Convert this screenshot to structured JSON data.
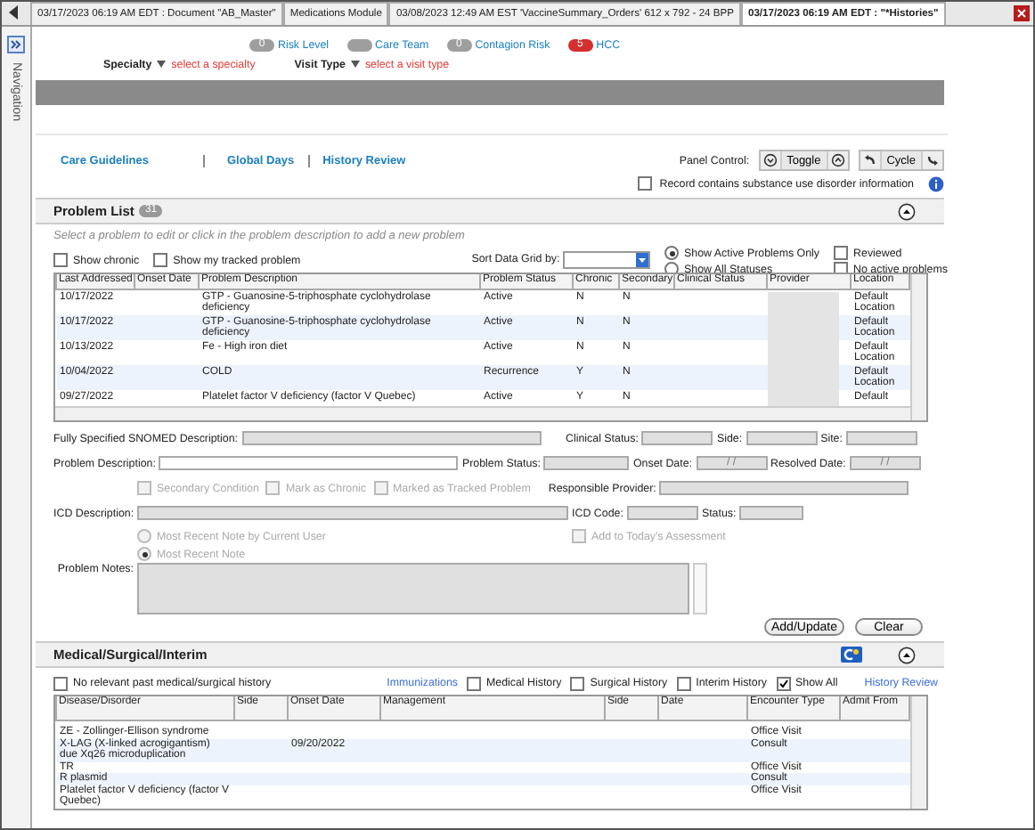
{
  "tabs": [
    {
      "label": "03/17/2023 06:19 AM EDT : Document \"AB_Master\"",
      "selected": false
    },
    {
      "label": "Medications Module",
      "selected": false
    },
    {
      "label": "03/08/2023 12:49 AM EST 'VaccineSummary_Orders' 612 x 792 - 24 BPP",
      "selected": false
    },
    {
      "label": "03/17/2023 06:19 AM EDT : \"*Histories\"",
      "selected": true
    }
  ],
  "navigation": {
    "label": "Navigation"
  },
  "indicators": [
    {
      "label": "Risk Level",
      "count": "0",
      "color": "#9e9e9e"
    },
    {
      "label": "Care Team",
      "color": "#9e9e9e"
    },
    {
      "label": "Contagion Risk",
      "count": "0",
      "color": "#9e9e9e"
    },
    {
      "label": "HCC",
      "count": "5",
      "color": "#d32f2f"
    }
  ],
  "selectors": [
    {
      "label": "Specialty",
      "value": "select a specialty"
    },
    {
      "label": "Visit Type",
      "value": "select a visit type"
    }
  ],
  "links": [
    "Care Guidelines",
    "Global Days",
    "History Review"
  ],
  "panel_control": {
    "label": "Panel Control:",
    "buttons": [
      "Toggle",
      "Cycle"
    ]
  },
  "substance_checkbox": {
    "label": "Record contains substance use disorder information",
    "checked": false
  },
  "problem_list": {
    "title": "Problem List",
    "count": "31",
    "hint": "Select a problem to edit or click in the problem description to add a new problem",
    "checkboxes": [
      {
        "label": "Show chronic",
        "checked": false
      },
      {
        "label": "Show my tracked problem",
        "checked": false
      }
    ],
    "sort_label": "Sort Data Grid by:",
    "status_filter": [
      {
        "label": "Show Active Problems Only",
        "selected": true
      },
      {
        "label": "Show All Statuses",
        "selected": false
      }
    ],
    "extra_checkboxes": [
      {
        "label": "Reviewed",
        "checked": false
      },
      {
        "label": "No active problems",
        "checked": false
      }
    ],
    "columns": [
      "Last Addressed",
      "Onset Date",
      "Problem Description",
      "Problem Status",
      "Chronic",
      "Secondary",
      "Clinical Status",
      "Provider",
      "Location"
    ],
    "rows": [
      {
        "last_addressed": "10/17/2022",
        "problem_description": "GTP - Guanosine-5-triphosphate cyclohydrolase deficiency",
        "problem_status": "Active",
        "chronic": "N",
        "secondary": "N",
        "location": "Default Location"
      },
      {
        "last_addressed": "10/17/2022",
        "problem_description": "GTP - Guanosine-5-triphosphate cyclohydrolase deficiency",
        "problem_status": "Active",
        "chronic": "N",
        "secondary": "N",
        "location": "Default Location"
      },
      {
        "last_addressed": "10/13/2022",
        "problem_description": "Fe - High iron diet",
        "problem_status": "Active",
        "chronic": "N",
        "secondary": "N",
        "location": "Default Location"
      },
      {
        "last_addressed": "10/04/2022",
        "problem_description": "COLD",
        "problem_status": "Recurrence",
        "chronic": "Y",
        "secondary": "N",
        "location": "Default Location"
      },
      {
        "last_addressed": "09/27/2022",
        "problem_description": "Platelet factor V deficiency (factor V Quebec)",
        "problem_status": "Active",
        "chronic": "Y",
        "secondary": "N",
        "location": "Default"
      }
    ]
  },
  "form": {
    "snomed_description": {
      "label": "Fully Specified SNOMED Description:",
      "disabled": true
    },
    "clinical_status": {
      "label": "Clinical Status:",
      "disabled": true
    },
    "side": {
      "label": "Side:",
      "disabled": true
    },
    "site": {
      "label": "Site:",
      "disabled": true
    },
    "problem_description": {
      "label": "Problem Description:",
      "disabled": false
    },
    "problem_status": {
      "label": "Problem Status:",
      "disabled": true
    },
    "onset_date": {
      "label": "Onset Date:",
      "value": "/ /",
      "disabled": true
    },
    "resolved_date": {
      "label": "Resolved Date:",
      "value": "/ /",
      "disabled": true
    },
    "options": [
      {
        "label": "Secondary Condition",
        "checked": false,
        "disabled": true
      },
      {
        "label": "Mark as Chronic",
        "checked": false,
        "disabled": true
      },
      {
        "label": "Marked as Tracked Problem",
        "checked": false,
        "disabled": true
      }
    ],
    "responsible_provider": {
      "label": "Responsible Provider:",
      "disabled": true
    },
    "icd_description": {
      "label": "ICD Description:",
      "disabled": true
    },
    "icd_code": {
      "label": "ICD Code:",
      "disabled": true
    },
    "status": {
      "label": "Status:",
      "disabled": true
    },
    "note_source": [
      {
        "label": "Most Recent Note by Current User",
        "selected": false,
        "disabled": true
      },
      {
        "label": "Most Recent Note",
        "selected": true,
        "disabled": true
      }
    ],
    "add_to_assessment": {
      "label": "Add to Today's Assessment",
      "checked": false,
      "disabled": true
    },
    "problem_notes": {
      "label": "Problem Notes:",
      "disabled": true
    },
    "buttons": [
      "Add/Update",
      "Clear"
    ]
  },
  "medical": {
    "title": "Medical/Surgical/Interim",
    "no_history": {
      "label": "No relevant past medical/surgical history",
      "checked": false
    },
    "immunizations_link": "Immunizations",
    "filters": [
      {
        "label": "Medical History",
        "checked": false
      },
      {
        "label": "Surgical History",
        "checked": false
      },
      {
        "label": "Interim History",
        "checked": false
      },
      {
        "label": "Show All",
        "checked": true
      }
    ],
    "history_review_link": "History Review",
    "columns": [
      "Disease/Disorder",
      "Side",
      "Onset Date",
      "Management",
      "Side",
      "Date",
      "Encounter Type",
      "Admit From"
    ],
    "rows": [
      {
        "disease_disorder": "ZE - Zollinger-Ellison syndrome",
        "encounter_type": "Office Visit"
      },
      {
        "disease_disorder": "X-LAG (X-linked acrogigantism) due Xq26 microduplication",
        "onset_date": "09/20/2022",
        "encounter_type": "Consult"
      },
      {
        "disease_disorder": "TR",
        "encounter_type": "Office Visit"
      },
      {
        "disease_disorder": "R plasmid",
        "encounter_type": "Consult"
      },
      {
        "disease_disorder": "Platelet factor V deficiency (factor V Quebec)",
        "encounter_type": "Office Visit"
      }
    ]
  }
}
